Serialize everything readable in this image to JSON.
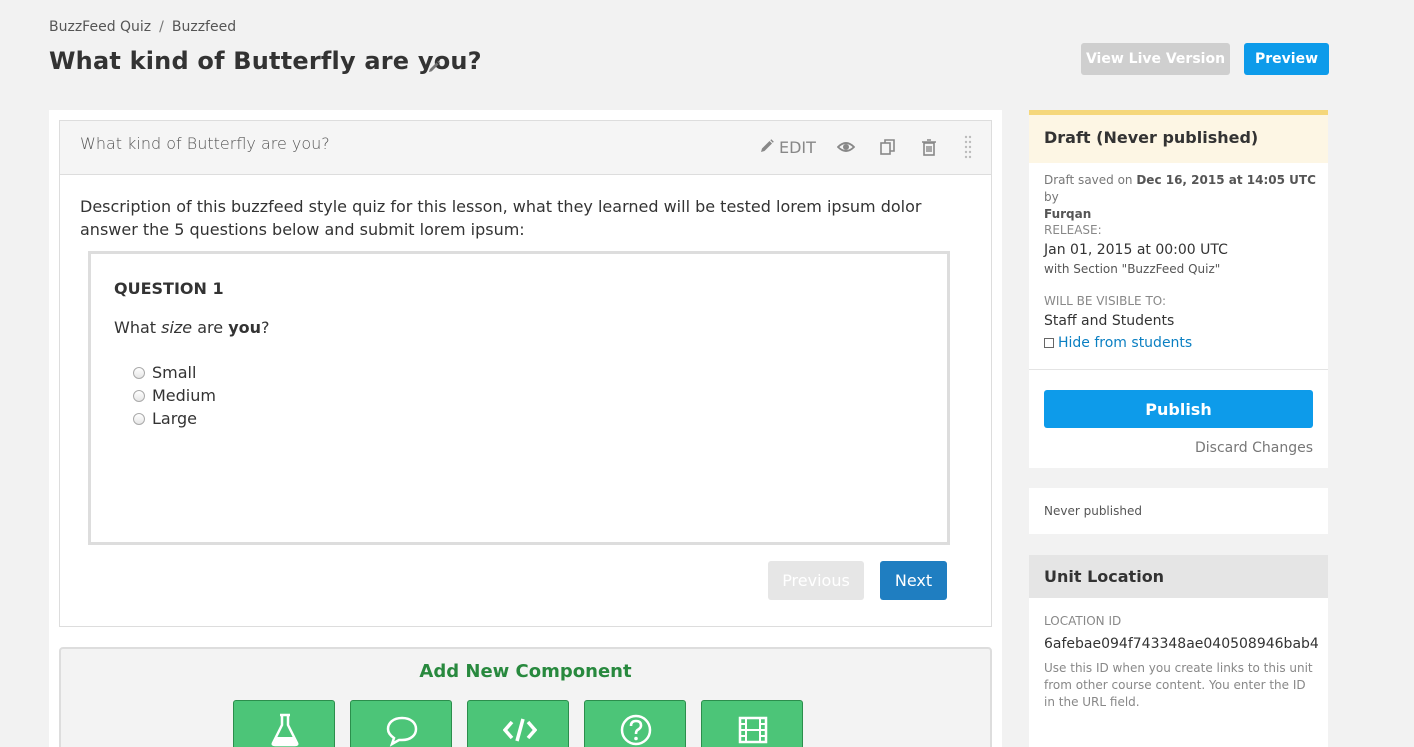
{
  "breadcrumb": {
    "item1": "BuzzFeed Quiz",
    "separator": "/",
    "item2": "Buzzfeed"
  },
  "page_title": "What kind of Butterfly are you?",
  "header_buttons": {
    "view_live": "View Live Version",
    "preview": "Preview"
  },
  "xblock": {
    "name": "What kind of Butterfly are you?",
    "edit_label": "EDIT",
    "icons": [
      "pencil-icon",
      "eye-icon",
      "duplicate-icon",
      "trash-icon",
      "drag-handle-icon"
    ]
  },
  "description": "Description of this buzzfeed style quiz for this lesson, what they learned will be tested lorem ipsum dolor answer the 5 questions below and submit lorem ipsum:",
  "question": {
    "label": "QUESTION 1",
    "text_prefix": "What ",
    "text_em": "size",
    "text_mid": " are ",
    "text_strong": "you",
    "text_suffix": "?",
    "options": [
      "Small",
      "Medium",
      "Large"
    ]
  },
  "nav": {
    "previous": "Previous",
    "next": "Next"
  },
  "add_component": {
    "title": "Add New Component",
    "buttons": [
      "flask-icon",
      "speech-bubble-icon",
      "code-icon",
      "question-icon",
      "film-icon"
    ]
  },
  "status": {
    "title": "Draft (Never published)",
    "saved_prefix": "Draft saved on ",
    "saved_date": "Dec 16, 2015 at 14:05 UTC",
    "saved_by": " by",
    "saved_user": "Furqan",
    "release_label": "RELEASE:",
    "release_value": "Jan 01, 2015 at 00:00 UTC",
    "release_section": "with Section \"BuzzFeed Quiz\"",
    "visible_label": "WILL BE VISIBLE TO:",
    "visible_value": "Staff and Students",
    "hide_label": "Hide from students",
    "publish": "Publish",
    "discard": "Discard Changes"
  },
  "never_published": "Never published",
  "location": {
    "title": "Unit Location",
    "id_label": "LOCATION ID",
    "id_value": "6afebae094f743348ae040508946bab4",
    "help": "Use this ID when you create links to this unit from other course content. You enter the ID in the URL field."
  },
  "colors": {
    "accent": "#0d9bea",
    "next": "#1f7ec1",
    "component": "#4cc578",
    "component_title": "#28893e",
    "draft_bar": "#f5d77b"
  }
}
